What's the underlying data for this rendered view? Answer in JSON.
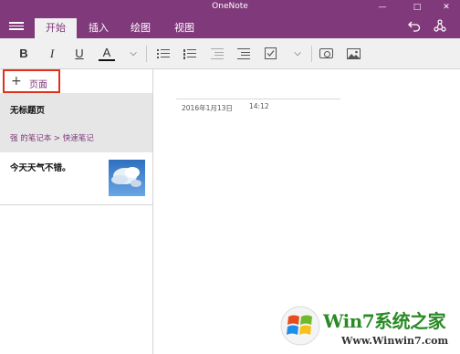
{
  "window": {
    "title": "OneNote",
    "minimize": "—",
    "maximize": "□",
    "close": "✕"
  },
  "ribbon": {
    "tabs": [
      {
        "label": "开始",
        "active": true
      },
      {
        "label": "插入",
        "active": false
      },
      {
        "label": "绘图",
        "active": false
      },
      {
        "label": "视图",
        "active": false
      }
    ],
    "undo_icon": "undo-icon",
    "share_icon": "share-icon"
  },
  "toolbar": {
    "bold": "B",
    "italic": "I",
    "underline": "U",
    "font_color": "A",
    "font_color_accent": "#111111",
    "dropdown": "⌵",
    "list_dropdown": "⌵"
  },
  "left_pane": {
    "add_page_label": "页面",
    "add_page_plus": "+",
    "pages": [
      {
        "title": "无标题页",
        "subtitle": "强 的笔记本 > 快速笔记",
        "selected": true
      },
      {
        "title": "今天天气不错。",
        "subtitle": "",
        "selected": false,
        "has_thumbnail": true
      }
    ]
  },
  "canvas": {
    "date": "2016年1月13日",
    "time": "14:12"
  },
  "watermark": {
    "brand": "Win7系统之家",
    "url": "Www.Winwin7.com"
  },
  "colors": {
    "accent": "#80397b",
    "highlight_border": "#e0301e",
    "selected_bg": "#e6e6e6",
    "toolbar_bg": "#f0f0f0"
  }
}
